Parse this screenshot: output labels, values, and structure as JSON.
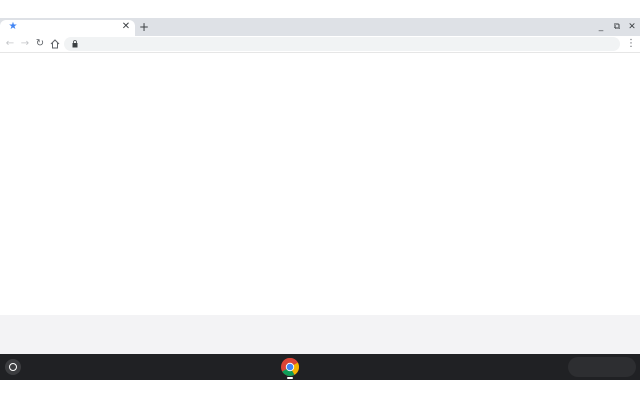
{
  "tab": {
    "title": "",
    "favicon_icon": "star-icon"
  },
  "window_controls": {
    "minimize_icon": "minimize-icon",
    "restore_icon": "restore-icon",
    "close_icon": "close-icon"
  },
  "toolbar": {
    "back_icon": "back-arrow-icon",
    "forward_icon": "forward-arrow-icon",
    "reload_icon": "reload-icon",
    "home_icon": "home-icon",
    "menu_icon": "kebab-menu-icon"
  },
  "omnibox": {
    "url": "",
    "lock_icon": "lock-icon"
  },
  "shelf": {
    "launcher_icon": "launcher-icon",
    "pinned_app_icon": "chrome-icon"
  },
  "colors": {
    "tabstrip": "#dee1e6",
    "omnibox": "#f1f3f4",
    "shelf": "#202124",
    "favicon": "#4285f4"
  }
}
